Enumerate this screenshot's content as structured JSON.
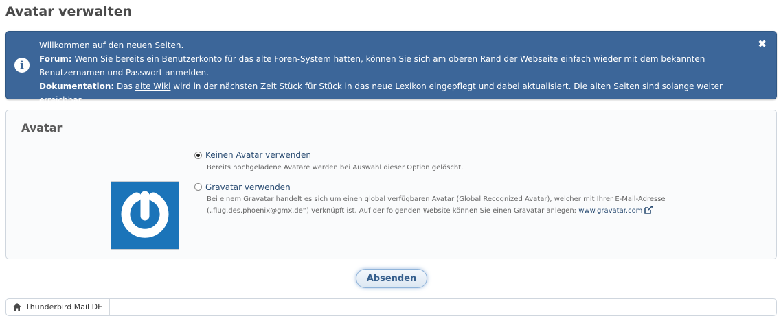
{
  "page": {
    "title": "Avatar verwalten"
  },
  "notice": {
    "heading": "Willkommen auf den neuen Seiten.",
    "forum_label": "Forum:",
    "forum_text": " Wenn Sie bereits ein Benutzerkonto für das alte Foren-System hatten, können Sie sich am oberen Rand der Webseite einfach wieder mit dem bekannten Benutzernamen und Passwort anmelden.",
    "doc_label": "Dokumentation:",
    "doc_text_before": " Das ",
    "doc_link": "alte Wiki",
    "doc_text_after": " wird in der nächsten Zeit Stück für Stück in das neue Lexikon eingepflegt und dabei aktualisiert. Die alten Seiten sind solange weiter erreichbar.",
    "info_icon": "i",
    "close_icon": "✖"
  },
  "avatar": {
    "section_title": "Avatar",
    "options": [
      {
        "label": "Keinen Avatar verwenden",
        "description": "Bereits hochgeladene Avatare werden bei Auswahl dieser Option gelöscht.",
        "selected": true
      },
      {
        "label": "Gravatar verwenden",
        "description_line1": "Bei einem Gravatar handelt es sich um einen global verfügbaren Avatar (Global Recognized Avatar), welcher mit Ihrer E-Mail-Adresse",
        "description_line2": "(„flug.des.phoenix@gmx.de“) verknüpft ist. Auf der folgenden Website können Sie einen Gravatar anlegen: ",
        "link": "www.gravatar.com",
        "selected": false
      }
    ],
    "image_icon": "gravatar-logo",
    "image_color": "#1b74b9"
  },
  "form": {
    "submit_label": "Absenden"
  },
  "breadcrumb": {
    "items": [
      {
        "label": "Thunderbird Mail DE",
        "icon": "home-icon"
      }
    ]
  }
}
